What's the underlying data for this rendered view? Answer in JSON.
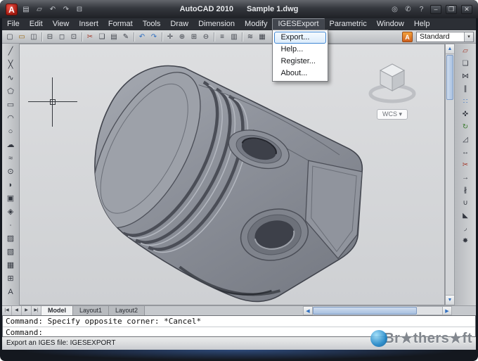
{
  "window": {
    "title_app": "AutoCAD 2010",
    "title_doc": "Sample 1.dwg"
  },
  "titlebar": {
    "logo_letter": "A",
    "left_icons": {
      "menu_browser": "▤",
      "open": "▱",
      "undo": "↶",
      "redo": "↷",
      "plot": "⊟"
    },
    "right_icons": {
      "search": "◎",
      "communication": "✆",
      "help": "?"
    },
    "window_controls": {
      "minimize": "–",
      "restore": "❐",
      "close": "✕"
    }
  },
  "menu_bar": {
    "items": [
      "File",
      "Edit",
      "View",
      "Insert",
      "Format",
      "Tools",
      "Draw",
      "Dimension",
      "Modify",
      "IGESExport",
      "Parametric",
      "Window",
      "Help"
    ],
    "active_item": "IGESExport"
  },
  "iges_menu": {
    "items": [
      "Export...",
      "Help...",
      "Register...",
      "About..."
    ],
    "highlighted": "Export..."
  },
  "toolbar": {
    "icons": {
      "qnew": "▢",
      "open": "▭",
      "save": "◫",
      "plot": "⊟",
      "plot_preview": "◻",
      "publish": "⊡",
      "cut": "✂",
      "copy": "❏",
      "paste": "▤",
      "match_properties": "✎",
      "undo": "↶",
      "redo": "↷",
      "pan": "✛",
      "zoom_realtime": "⊕",
      "zoom_window": "⊞",
      "zoom_previous": "⊖",
      "properties": "≡",
      "design_center": "▥",
      "layers": "≋",
      "layer_properties": "▦"
    },
    "workspace_letter": "A",
    "style_value": "Standard",
    "combo_arrow": "▾"
  },
  "draw_toolbar": {
    "icons": {
      "line": "╱",
      "construction_line": "╳",
      "polyline": "∿",
      "polygon": "⬠",
      "rectangle": "▭",
      "arc": "◠",
      "circle": "○",
      "revision_cloud": "☁",
      "spline": "≈",
      "ellipse": "⊙",
      "ellipse_arc": "◗",
      "insert_block": "▣",
      "make_block": "◈",
      "point": "∙",
      "hatch": "▨",
      "gradient": "▧",
      "region": "▦",
      "table": "⊞",
      "multiline_text": "A"
    }
  },
  "modify_toolbar": {
    "icons": {
      "erase": "▱",
      "copy": "❏",
      "mirror": "⋈",
      "offset": "∥",
      "array": "∷",
      "move": "✜",
      "rotate": "↻",
      "scale": "◿",
      "stretch": "↔",
      "trim": "✂",
      "extend": "→",
      "break": "∦",
      "join": "∪",
      "chamfer": "◣",
      "fillet": "◞",
      "explode": "✸"
    }
  },
  "viewcube": {
    "label": "WCS",
    "arrow": "▾"
  },
  "scrollbars": {
    "up": "▲",
    "down": "▼",
    "left": "◀",
    "right": "▶"
  },
  "layout_tabs": {
    "nav": {
      "first": "|◀",
      "prev": "◀",
      "next": "▶",
      "last": "▶|"
    },
    "tabs": [
      "Model",
      "Layout1",
      "Layout2"
    ],
    "active": "Model"
  },
  "command_window": {
    "history": "Command: Specify opposite corner: *Cancel*",
    "prompt": "Command:"
  },
  "status_bar": {
    "text": "Export an IGES file: IGESEXPORT"
  },
  "watermark": {
    "text": "Br★thers★ft"
  },
  "colors": {
    "accent_blue": "#3f86d2",
    "viewport_gray": "#d6d8da",
    "model_gray": "#8f939c",
    "logo_red": "#c0271a",
    "scroll_blue": "#2f6ec0"
  }
}
